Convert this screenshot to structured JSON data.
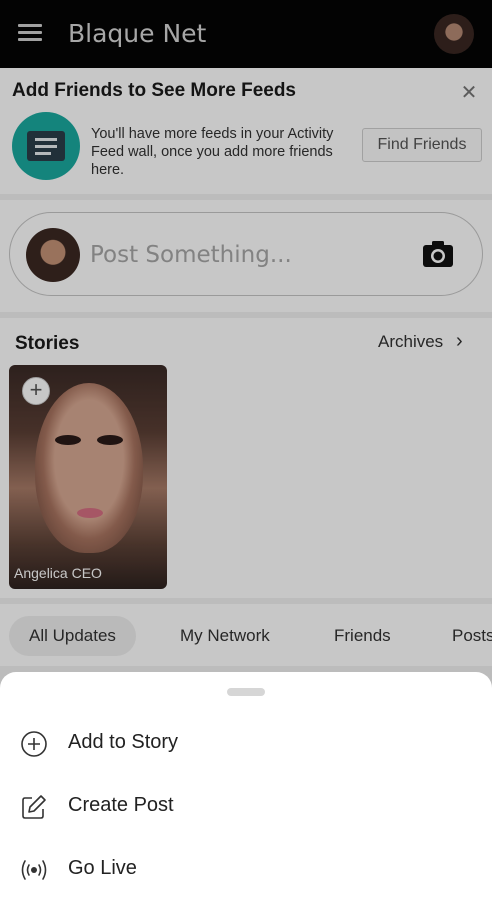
{
  "header": {
    "title": "Blaque Net",
    "menu_icon": "hamburger-menu-icon",
    "avatar_icon": "profile-avatar"
  },
  "friends_card": {
    "title": "Add Friends to See More Feeds",
    "description": "You'll have more feeds in your Activity Feed wall, once you add more friends here.",
    "button_label": "Find Friends",
    "close_icon": "close-icon",
    "illustration_color": "#1aa99f"
  },
  "composer": {
    "placeholder": "Post Something...",
    "camera_icon": "camera-icon"
  },
  "stories": {
    "title": "Stories",
    "archives_label": "Archives",
    "items": [
      {
        "name": "Angelica CEO",
        "add_icon": "plus-icon"
      }
    ]
  },
  "tabs": [
    {
      "label": "All Updates",
      "active": true
    },
    {
      "label": "My Network",
      "active": false
    },
    {
      "label": "Friends",
      "active": false
    },
    {
      "label": "Posts",
      "active": false
    }
  ],
  "sheet": {
    "items": [
      {
        "label": "Add to Story",
        "icon": "add-circle-icon"
      },
      {
        "label": "Create Post",
        "icon": "edit-icon"
      },
      {
        "label": "Go Live",
        "icon": "broadcast-icon"
      }
    ]
  },
  "colors": {
    "header_bg": "#050505",
    "overlay": "rgba(0,0,0,0.22)"
  }
}
